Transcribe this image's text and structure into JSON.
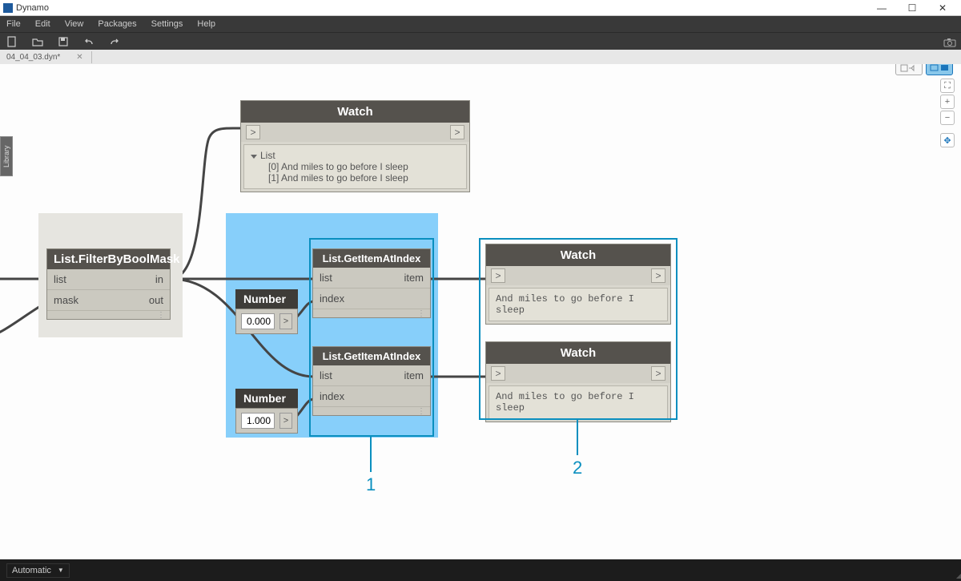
{
  "app_title": "Dynamo",
  "menu": {
    "file": "File",
    "edit": "Edit",
    "view": "View",
    "packages": "Packages",
    "settings": "Settings",
    "help": "Help"
  },
  "file_tab": {
    "name": "04_04_03.dyn*"
  },
  "runmode": {
    "label": "Automatic"
  },
  "library_tab": "Library",
  "nodes": {
    "filter": {
      "title": "List.FilterByBoolMask",
      "in1": "list",
      "in2": "mask",
      "out1": "in",
      "out2": "out"
    },
    "watch_top": {
      "title": "Watch",
      "arrow": ">",
      "list_label": "List",
      "items": [
        "[0] And miles to go before I sleep",
        "[1] And miles to go before I sleep"
      ]
    },
    "num1": {
      "title": "Number",
      "value": "0.000",
      "port": ">"
    },
    "num2": {
      "title": "Number",
      "value": "1.000",
      "port": ">"
    },
    "get1": {
      "title": "List.GetItemAtIndex",
      "in1": "list",
      "in2": "index",
      "out": "item"
    },
    "get2": {
      "title": "List.GetItemAtIndex",
      "in1": "list",
      "in2": "index",
      "out": "item"
    },
    "watch1": {
      "title": "Watch",
      "arrow": ">",
      "value": "And miles to go before I sleep"
    },
    "watch2": {
      "title": "Watch",
      "arrow": ">",
      "value": "And miles to go before I sleep"
    }
  },
  "callouts": {
    "c1": "1",
    "c2": "2"
  }
}
